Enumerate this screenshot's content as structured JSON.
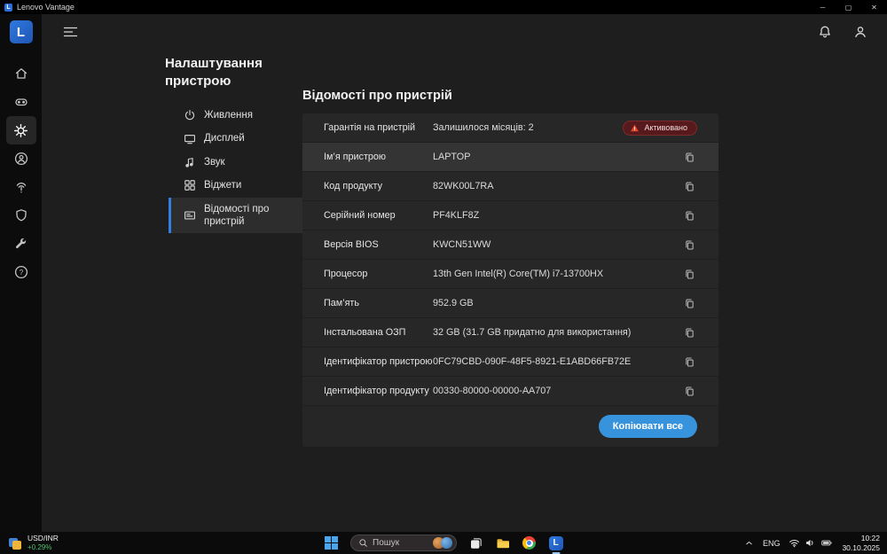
{
  "titlebar": {
    "title": "Lenovo Vantage",
    "logo_letter": "L",
    "minimize": "─",
    "maximize": "▢",
    "close": "✕"
  },
  "sidebar": {
    "logo_letter": "L",
    "icons": [
      "home-icon",
      "gamepad-icon",
      "settings-gear-icon",
      "account-icon",
      "fingerprint-icon",
      "shield-icon",
      "wrench-icon",
      "help-icon"
    ],
    "active_icon": "settings-gear-icon"
  },
  "nav": {
    "heading": "Налаштування пристрою",
    "items": [
      {
        "label": "Живлення"
      },
      {
        "label": "Дисплей"
      },
      {
        "label": "Звук"
      },
      {
        "label": "Віджети"
      },
      {
        "label": "Відомості про пристрій",
        "selected": true
      }
    ]
  },
  "main": {
    "title": "Відомості про пристрій",
    "warranty": {
      "label": "Гарантія на пристрій",
      "value": "Залишилося місяців: 2",
      "badge": "Активовано"
    },
    "rows": [
      {
        "label": "Ім’я пристрою",
        "value": "LAPTOP"
      },
      {
        "label": "Код продукту",
        "value": "82WK00L7RA"
      },
      {
        "label": "Серійний номер",
        "value": "PF4KLF8Z"
      },
      {
        "label": "Версія BIOS",
        "value": "KWCN51WW"
      },
      {
        "label": "Процесор",
        "value": "13th Gen Intel(R) Core(TM) i7-13700HX"
      },
      {
        "label": "Пам’ять",
        "value": "952.9 GB"
      },
      {
        "label": "Інстальована ОЗП",
        "value": "32 GB (31.7 GB придатно для використання)"
      },
      {
        "label": "Ідентифікатор пристрою",
        "value": "0FC79CBD-090F-48F5-8921-E1ABD66FB72E"
      },
      {
        "label": "Ідентифікатор продукту",
        "value": "00330-80000-00000-AA707"
      }
    ],
    "copy_all": "Копіювати все"
  },
  "taskbar": {
    "widget": {
      "ticker": "USD/INR",
      "change": "+0.29%"
    },
    "search": {
      "placeholder": "Пошук"
    },
    "tray": {
      "language": "ENG",
      "time": "10:22",
      "date": "30.10.2025"
    }
  },
  "colors": {
    "accent_blue": "#3793dc",
    "selected_bar_blue": "#2f80e0",
    "badge_red_bg": "#58191c",
    "warning_orange": "#e0472e",
    "positive_green": "#51c06f"
  }
}
